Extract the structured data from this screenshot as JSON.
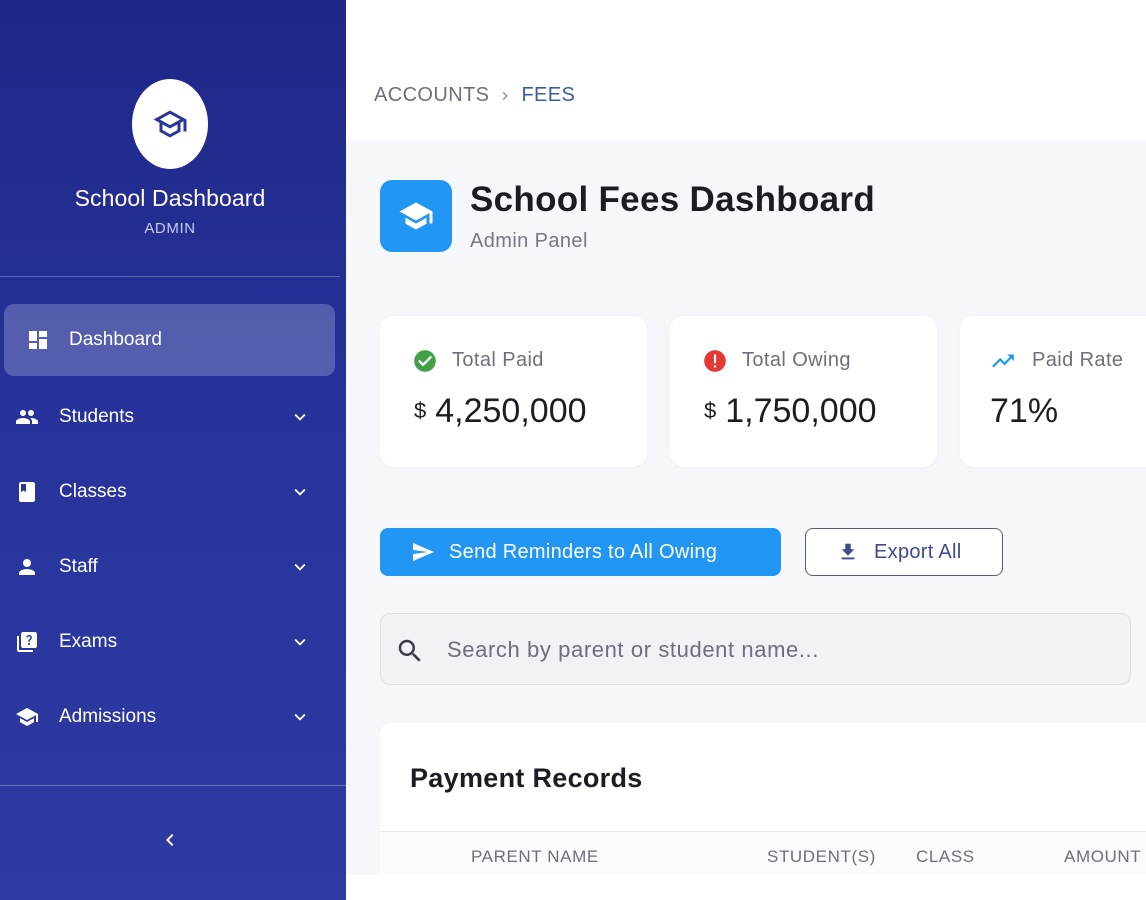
{
  "sidebar": {
    "brand": {
      "title": "School Dashboard",
      "role": "ADMIN"
    },
    "items": [
      {
        "label": "Dashboard",
        "icon": "dashboard-icon",
        "active": true
      },
      {
        "label": "Students",
        "icon": "people-icon",
        "active": false
      },
      {
        "label": "Classes",
        "icon": "class-book-icon",
        "active": false
      },
      {
        "label": "Staff",
        "icon": "person-icon",
        "active": false
      },
      {
        "label": "Exams",
        "icon": "quiz-icon",
        "active": false
      },
      {
        "label": "Admissions",
        "icon": "school-icon",
        "active": false
      }
    ]
  },
  "breadcrumb": {
    "parent": "ACCOUNTS",
    "current": "FEES"
  },
  "header": {
    "title": "School Fees Dashboard",
    "subtitle": "Admin Panel"
  },
  "stats": [
    {
      "label": "Total Paid",
      "currency": "$",
      "value": "4,250,000",
      "icon": "check-circle-icon",
      "color": "#43a047"
    },
    {
      "label": "Total Owing",
      "currency": "$",
      "value": "1,750,000",
      "icon": "error-icon",
      "color": "#e53935"
    },
    {
      "label": "Paid Rate",
      "currency": "",
      "value": "71%",
      "icon": "trending-up-icon",
      "color": "#2196f3"
    }
  ],
  "actions": {
    "send_reminders": "Send Reminders to All Owing",
    "export_all": "Export All"
  },
  "search": {
    "placeholder": "Search by parent or student name...",
    "value": ""
  },
  "records": {
    "title": "Payment Records",
    "columns": [
      "PARENT NAME",
      "STUDENT(S)",
      "CLASS",
      "AMOUNT"
    ]
  },
  "colors": {
    "sidebar_top": "#1f2787",
    "sidebar_bottom": "#2e3ba3",
    "accent": "#2196f3",
    "breadcrumb_active": "#3b5aa6",
    "content_bg": "#f5f7fa"
  }
}
